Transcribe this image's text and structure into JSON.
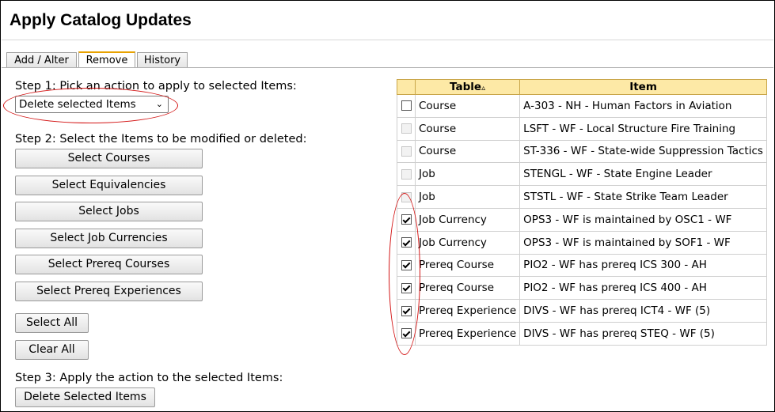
{
  "page": {
    "title": "Apply Catalog Updates"
  },
  "tabs": [
    {
      "label": "Add / Alter"
    },
    {
      "label": "Remove"
    },
    {
      "label": "History"
    }
  ],
  "step1": {
    "label": "Step 1: Pick an action to apply to selected Items:",
    "selected": "Delete selected Items"
  },
  "step2": {
    "label": "Step 2: Select the Items to be modified or deleted:",
    "buttons": [
      "Select Courses",
      "Select Equivalencies",
      "Select Jobs",
      "Select Job Currencies",
      "Select Prereq Courses",
      "Select Prereq Experiences"
    ],
    "select_all": "Select All",
    "clear_all": "Clear All"
  },
  "step3": {
    "label": "Step 3: Apply the action to the selected Items:",
    "button": "Delete Selected Items"
  },
  "table": {
    "headers": {
      "table": "Table",
      "item": "Item"
    },
    "rows": [
      {
        "type": "Course",
        "item": "A-303 - NH - Human Factors in Aviation",
        "state": "unchecked"
      },
      {
        "type": "Course",
        "item": "LSFT - WF - Local Structure Fire Training",
        "state": "disabled"
      },
      {
        "type": "Course",
        "item": "ST-336 - WF - State-wide Suppression Tactics",
        "state": "disabled"
      },
      {
        "type": "Job",
        "item": "STENGL - WF - State Engine Leader",
        "state": "disabled"
      },
      {
        "type": "Job",
        "item": "STSTL - WF - State Strike Team Leader",
        "state": "disabled"
      },
      {
        "type": "Job Currency",
        "item": "OPS3 - WF is maintained by OSC1 - WF",
        "state": "checked"
      },
      {
        "type": "Job Currency",
        "item": "OPS3 - WF is maintained by SOF1 - WF",
        "state": "checked"
      },
      {
        "type": "Prereq Course",
        "item": "PIO2 - WF has prereq ICS 300 - AH",
        "state": "checked"
      },
      {
        "type": "Prereq Course",
        "item": "PIO2 - WF has prereq ICS 400 - AH",
        "state": "checked"
      },
      {
        "type": "Prereq Experience",
        "item": "DIVS - WF has prereq ICT4 - WF (5)",
        "state": "checked"
      },
      {
        "type": "Prereq Experience",
        "item": "DIVS - WF has prereq STEQ - WF (5)",
        "state": "checked"
      }
    ]
  },
  "colors": {
    "accent_tab": "#e8a200",
    "header_bg": "#fde9a6",
    "annotation": "#d31414"
  }
}
